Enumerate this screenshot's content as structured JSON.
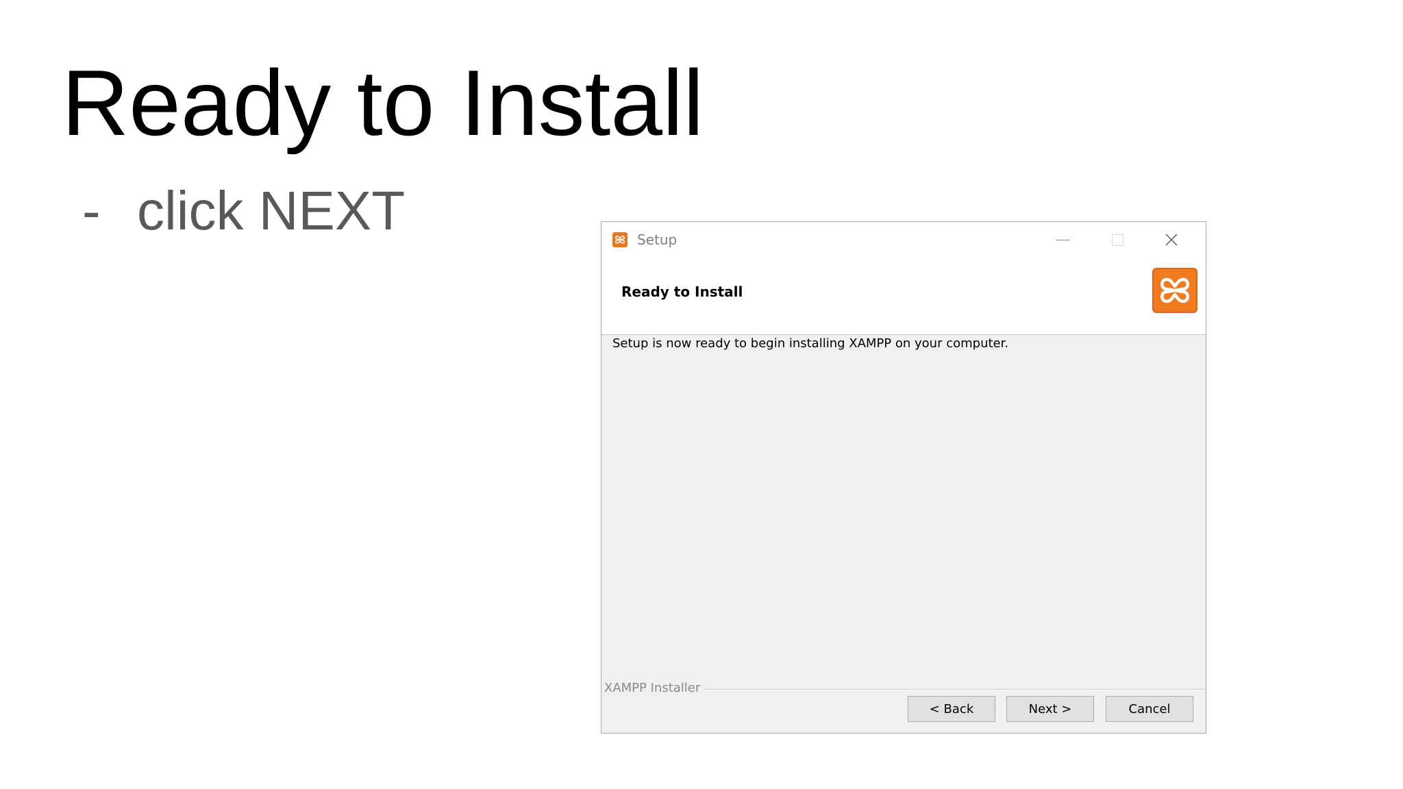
{
  "slide": {
    "title": "Ready to Install",
    "bullet_marker": "-",
    "bullet_text": "click NEXT"
  },
  "dialog": {
    "window_title": "Setup",
    "header_title": "Ready to Install",
    "body_text": "Setup is now ready to begin installing XAMPP on your computer.",
    "group_label": "XAMPP Installer",
    "buttons": {
      "back": "< Back",
      "next": "Next >",
      "cancel": "Cancel"
    },
    "icons": {
      "app": "xampp-icon",
      "logo": "xampp-logo",
      "minimize": "minimize-icon",
      "maximize": "maximize-icon",
      "close": "close-icon"
    },
    "colors": {
      "brand": "#f07a1e",
      "dialog_bg": "#f0f0f0",
      "button_bg": "#e1e1e1"
    }
  }
}
